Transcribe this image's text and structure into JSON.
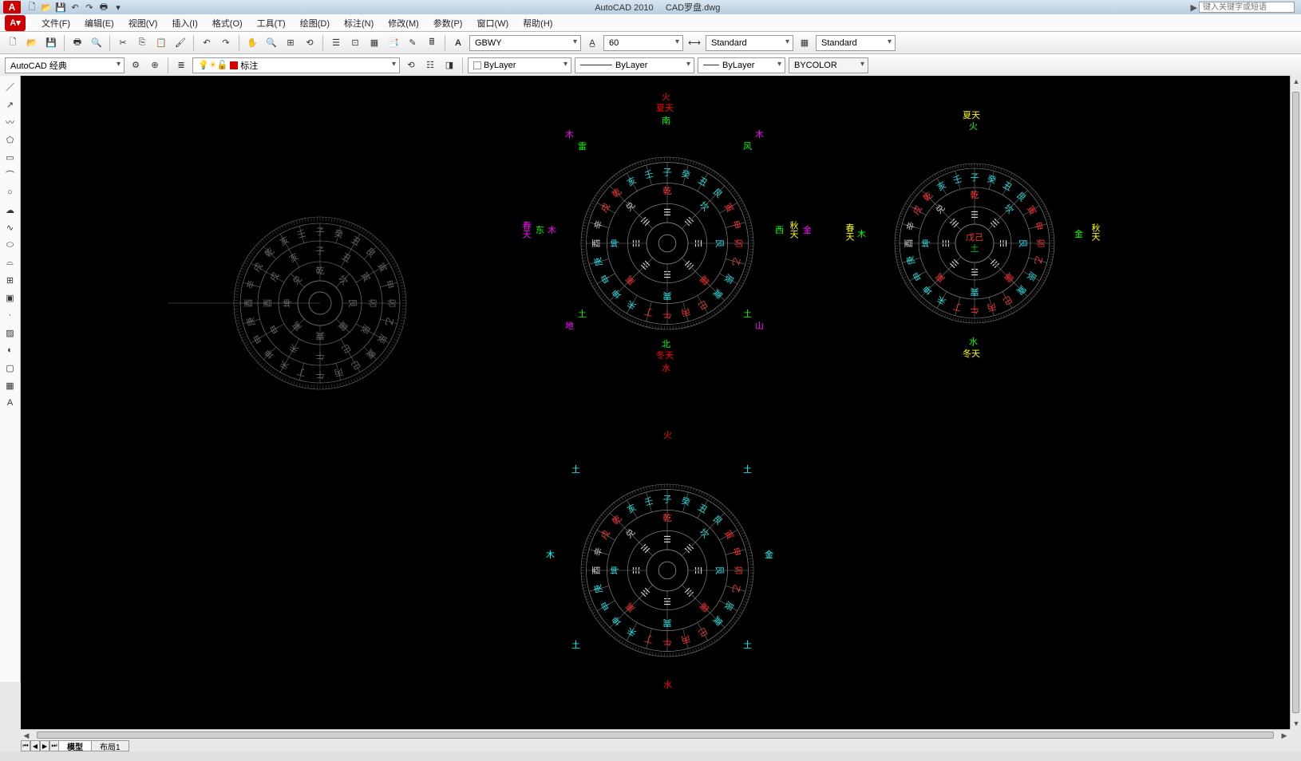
{
  "title": {
    "app": "AutoCAD 2010",
    "file": "CAD罗盘.dwg"
  },
  "search_placeholder": "键入关键字或短语",
  "menubar": [
    "文件(F)",
    "编辑(E)",
    "视图(V)",
    "插入(I)",
    "格式(O)",
    "工具(T)",
    "绘图(D)",
    "标注(N)",
    "修改(M)",
    "参数(P)",
    "窗口(W)",
    "帮助(H)"
  ],
  "toolbar1": {
    "font_combo": "GBWY",
    "size_combo": "60",
    "style_combo1": "Standard",
    "style_combo2": "Standard"
  },
  "toolbar2": {
    "workspace": "AutoCAD 经典",
    "layer_state": "标注",
    "layer_combo": "ByLayer",
    "linetype_combo": "ByLayer",
    "lineweight_combo": "ByLayer",
    "plotstyle_combo": "BYCOLOR"
  },
  "tabs": {
    "model": "模型",
    "layout1": "布局1"
  },
  "compass_common": {
    "ring24": [
      "子",
      "癸",
      "丑",
      "艮",
      "寅",
      "甲",
      "卯",
      "乙",
      "辰",
      "巽",
      "巳",
      "丙",
      "午",
      "丁",
      "未",
      "坤",
      "申",
      "庚",
      "酉",
      "辛",
      "戌",
      "乾",
      "亥",
      "壬"
    ],
    "ring12": [
      "子",
      "丑",
      "寅",
      "卯",
      "辰",
      "巳",
      "午",
      "未",
      "申",
      "酉",
      "戌",
      "亥"
    ],
    "trigrams8": [
      "乾",
      "坎",
      "艮",
      "震",
      "巽",
      "离",
      "坤",
      "兑"
    ],
    "bagua_glyphs": [
      "☰",
      "☵",
      "☶",
      "☳",
      "☴",
      "☲",
      "☷",
      "☱"
    ]
  },
  "compass2": {
    "top": [
      "火",
      "夏天",
      "南"
    ],
    "bottom": [
      "北",
      "冬天",
      "水"
    ],
    "left": [
      "春天",
      "东",
      "木"
    ],
    "right": [
      "西",
      "秋天",
      "金"
    ],
    "diag_ne": [
      "木",
      "风"
    ],
    "diag_nw": [
      "木",
      "雷"
    ],
    "diag_se": [
      "土",
      "山"
    ],
    "diag_sw": [
      "土",
      "地"
    ]
  },
  "compass3": {
    "top": [
      "夏天",
      "火"
    ],
    "bottom": [
      "水",
      "冬天"
    ],
    "left": [
      "春天",
      "木"
    ],
    "right": [
      "金",
      "秋天"
    ],
    "center": [
      "戊己",
      "土"
    ]
  },
  "compass4": {
    "top": "火",
    "bottom": "水",
    "left": "木",
    "right": "金",
    "diag": [
      "土",
      "土",
      "土",
      "土"
    ]
  }
}
